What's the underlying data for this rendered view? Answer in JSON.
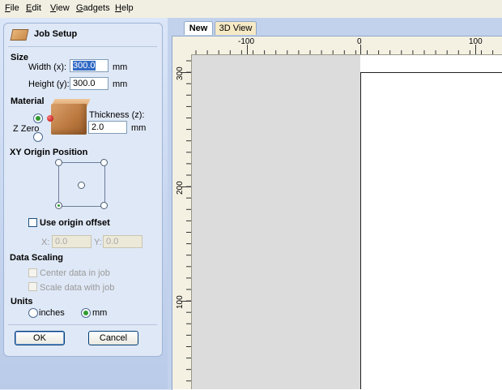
{
  "menu": [
    "File",
    "Edit",
    "View",
    "Gadgets",
    "Help"
  ],
  "menu_underline": [
    "F",
    "E",
    "V",
    "G",
    "H"
  ],
  "panel": {
    "title": "Job Setup",
    "size": {
      "heading": "Size",
      "width_label": "Width (x):",
      "width_value": "300.0",
      "height_label": "Height (y):",
      "height_value": "300.0",
      "unit": "mm"
    },
    "material": {
      "heading": "Material",
      "z_zero_label": "Z Zero",
      "z_zero_selected": "top",
      "thickness_label": "Thickness (z):",
      "thickness_value": "2.0",
      "unit": "mm"
    },
    "xy_origin": {
      "heading": "XY Origin Position",
      "selected": "bottom-left",
      "use_offset_label": "Use origin offset",
      "use_offset_checked": false,
      "x_label": "X:",
      "x_value": "0.0",
      "y_label": "Y:",
      "y_value": "0.0"
    },
    "data_scaling": {
      "heading": "Data Scaling",
      "center_label": "Center data in job",
      "scale_label": "Scale data with job"
    },
    "units": {
      "heading": "Units",
      "inches_label": "inches",
      "mm_label": "mm",
      "selected": "mm"
    },
    "ok_label": "OK",
    "cancel_label": "Cancel"
  },
  "tabs": [
    {
      "label": "New",
      "active": true
    },
    {
      "label": "3D View",
      "active": false
    }
  ],
  "ruler": {
    "h_labels": [
      "-100",
      "0",
      "100"
    ],
    "v_labels": [
      "300",
      "200",
      "100"
    ]
  },
  "colors": {
    "accent": "#316ac5",
    "radio_selected": "#2f9a2f",
    "panel_bg": "#dfe8f6"
  }
}
